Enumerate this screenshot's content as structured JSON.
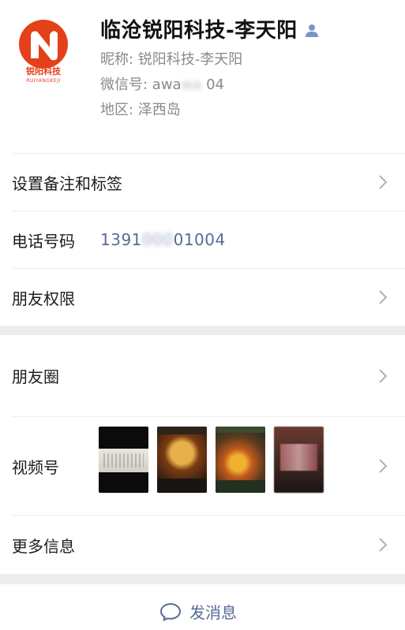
{
  "profile": {
    "display_name": "临沧锐阳科技-李天阳",
    "nickname_line": "昵称:  锐阳科技-李天阳",
    "wechat_id_label": "微信号:  awa",
    "wechat_id_blur": "wa",
    "wechat_id_suffix": "   04",
    "region_line": "地区:  泽西岛",
    "logo_text_cn": "锐阳科技",
    "logo_text_en": "RUIYANGKEJI",
    "logo_color": "#e4401a"
  },
  "rows": {
    "remark_label": "设置备注和标签",
    "phone_label": "电话号码",
    "phone_value_prefix": "1391",
    "phone_value_blur": "000",
    "phone_value_suffix": "01004",
    "permissions_label": "朋友权限",
    "moments_label": "朋友圈",
    "channels_label": "视频号",
    "more_info_label": "更多信息"
  },
  "actions": {
    "send_message_label": "发消息"
  },
  "colors": {
    "link": "#576b95",
    "separator_gap": "#ededed",
    "chevron": "#b2b2b2"
  }
}
